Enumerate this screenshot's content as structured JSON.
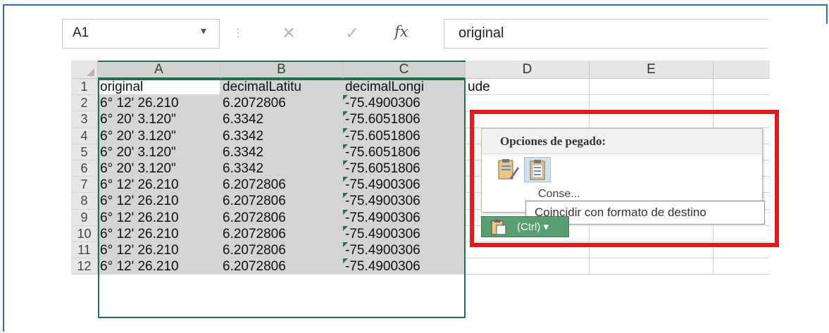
{
  "formula_bar": {
    "name_box": "A1",
    "formula": "original",
    "cancel_icon": "✕",
    "enter_icon": "✓",
    "fx_label": "fx"
  },
  "columns": [
    "A",
    "B",
    "C",
    "D",
    "E"
  ],
  "rows": [
    {
      "num": "1",
      "a": "original",
      "b": "decimalLatitu",
      "c": "decimalLongi",
      "d": "ude"
    },
    {
      "num": "2",
      "a": "6° 12' 26.210",
      "b": "6.2072806",
      "c": "-75.4900306"
    },
    {
      "num": "3",
      "a": "6° 20' 3.120\"",
      "b": "6.3342",
      "c": "-75.6051806"
    },
    {
      "num": "4",
      "a": "6° 20' 3.120\"",
      "b": "6.3342",
      "c": "-75.6051806"
    },
    {
      "num": "5",
      "a": "6° 20' 3.120\"",
      "b": "6.3342",
      "c": "-75.6051806"
    },
    {
      "num": "6",
      "a": "6° 20' 3.120\"",
      "b": "6.3342",
      "c": "-75.6051806"
    },
    {
      "num": "7",
      "a": "6° 12' 26.210",
      "b": "6.2072806",
      "c": "-75.4900306"
    },
    {
      "num": "8",
      "a": "6° 12' 26.210",
      "b": "6.2072806",
      "c": "-75.4900306"
    },
    {
      "num": "9",
      "a": "6° 12' 26.210",
      "b": "6.2072806",
      "c": "-75.4900306"
    },
    {
      "num": "10",
      "a": "6° 12' 26.210",
      "b": "6.2072806",
      "c": "-75.4900306"
    },
    {
      "num": "11",
      "a": "6° 12' 26.210",
      "b": "6.2072806",
      "c": "-75.4900306"
    },
    {
      "num": "12",
      "a": "6° 12' 26.210",
      "b": "6.2072806",
      "c": "-75.4900306"
    }
  ],
  "paste_options": {
    "title": "Opciones de pegado:",
    "option_icons": [
      "paste-keep-source-formatting-icon",
      "paste-match-destination-icon"
    ],
    "partial_text": "Conse...",
    "tooltip": "Coincidir con formato de destino",
    "ctrl_label": "(Ctrl) ▾"
  },
  "colors": {
    "selection_green": "#217346",
    "highlight_red": "#e21b1b",
    "ctrl_button": "#5a9e73"
  }
}
